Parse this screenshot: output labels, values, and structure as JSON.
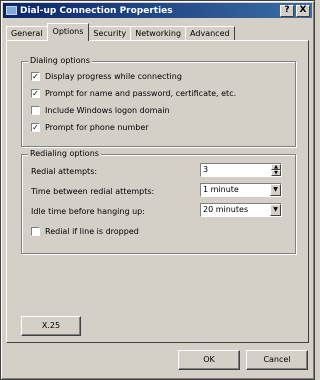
{
  "window": {
    "title": "Dial-up Connection Properties",
    "help_label": "?",
    "close_label": "X"
  },
  "tabs": [
    {
      "label": "General",
      "active": false
    },
    {
      "label": "Options",
      "active": true
    },
    {
      "label": "Security",
      "active": false
    },
    {
      "label": "Networking",
      "active": false
    },
    {
      "label": "Advanced",
      "active": false
    }
  ],
  "dialing_options": {
    "legend": "Dialing options",
    "items": [
      {
        "label": "Display progress while connecting",
        "checked": true
      },
      {
        "label": "Prompt for name and password, certificate, etc.",
        "checked": true
      },
      {
        "label": "Include Windows logon domain",
        "checked": false
      },
      {
        "label": "Prompt for phone number",
        "checked": true
      }
    ]
  },
  "redialing_options": {
    "legend": "Redialing options",
    "redial_attempts_label": "Redial attempts:",
    "redial_attempts_value": "3",
    "time_between_label": "Time between redial attempts:",
    "time_between_value": "1 minute",
    "idle_time_label": "Idle time before hanging up:",
    "idle_time_value": "20 minutes",
    "redial_if_dropped_label": "Redial if line is dropped",
    "redial_if_dropped_checked": false
  },
  "x25_button_label": "X.25",
  "ok_label": "OK",
  "cancel_label": "Cancel",
  "colors": {
    "titlebar_start": "#0a246a",
    "titlebar_end": "#3a6ea5",
    "face": "#d4d0c8"
  }
}
